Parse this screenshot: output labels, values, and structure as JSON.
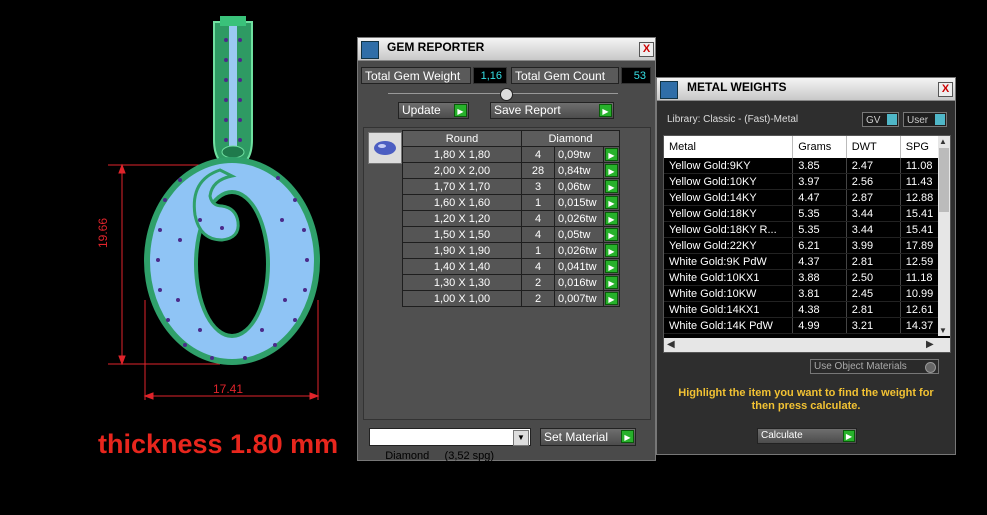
{
  "viewport": {
    "dim_height": "19.66",
    "dim_width": "17.41",
    "thickness_text": "thickness 1.80 mm"
  },
  "gem_reporter": {
    "title": "GEM REPORTER",
    "close": "X",
    "total_weight_label": "Total Gem Weight",
    "total_weight_value": "1,16",
    "total_count_label": "Total Gem Count",
    "total_count_value": "53",
    "update_label": "Update",
    "save_report_label": "Save Report",
    "col_shape": "Round",
    "col_type": "Diamond",
    "rows": [
      {
        "size": "1,80 X 1,80",
        "count": "4",
        "weight": "0,09tw"
      },
      {
        "size": "2,00 X 2,00",
        "count": "28",
        "weight": "0,84tw"
      },
      {
        "size": "1,70 X 1,70",
        "count": "3",
        "weight": "0,06tw"
      },
      {
        "size": "1,60 X 1,60",
        "count": "1",
        "weight": "0,015tw"
      },
      {
        "size": "1,20 X 1,20",
        "count": "4",
        "weight": "0,026tw"
      },
      {
        "size": "1,50 X 1,50",
        "count": "4",
        "weight": "0,05tw"
      },
      {
        "size": "1,90 X 1,90",
        "count": "1",
        "weight": "0,026tw"
      },
      {
        "size": "1,40 X 1,40",
        "count": "4",
        "weight": "0,041tw"
      },
      {
        "size": "1,30 X 1,30",
        "count": "2",
        "weight": "0,016tw"
      },
      {
        "size": "1,00 X 1,00",
        "count": "2",
        "weight": "0,007tw"
      }
    ],
    "material_select": "Diamond     (3,52 spg)",
    "set_material_label": "Set Material"
  },
  "metal_weights": {
    "title": "METAL WEIGHTS",
    "close": "X",
    "library": "Library: Classic - (Fast)-Metal",
    "gv_label": "GV",
    "user_label": "User",
    "headers": [
      "Metal",
      "Grams",
      "DWT",
      "SPG"
    ],
    "rows": [
      [
        "Yellow Gold:9KY",
        "3.85",
        "2.47",
        "11.08"
      ],
      [
        "Yellow Gold:10KY",
        "3.97",
        "2.56",
        "11.43"
      ],
      [
        "Yellow Gold:14KY",
        "4.47",
        "2.87",
        "12.88"
      ],
      [
        "Yellow Gold:18KY",
        "5.35",
        "3.44",
        "15.41"
      ],
      [
        "Yellow Gold:18KY R...",
        "5.35",
        "3.44",
        "15.41"
      ],
      [
        "Yellow Gold:22KY",
        "6.21",
        "3.99",
        "17.89"
      ],
      [
        "White Gold:9K PdW",
        "4.37",
        "2.81",
        "12.59"
      ],
      [
        "White Gold:10KX1",
        "3.88",
        "2.50",
        "11.18"
      ],
      [
        "White Gold:10KW",
        "3.81",
        "2.45",
        "10.99"
      ],
      [
        "White Gold:14KX1",
        "4.38",
        "2.81",
        "12.61"
      ],
      [
        "White Gold:14K PdW",
        "4.99",
        "3.21",
        "14.37"
      ]
    ],
    "use_object_materials": "Use Object Materials",
    "instruction": "Highlight the item you want to find the weight for then press calculate.",
    "calculate_label": "Calculate"
  },
  "colors": {
    "accent_green": "#27b12b",
    "value_cyan": "#35e0e6",
    "dimension_red": "#e0242b",
    "instruction_yellow": "#f2c233",
    "gem_blue": "#8fc4f5",
    "metal_green": "#2fa06a"
  }
}
